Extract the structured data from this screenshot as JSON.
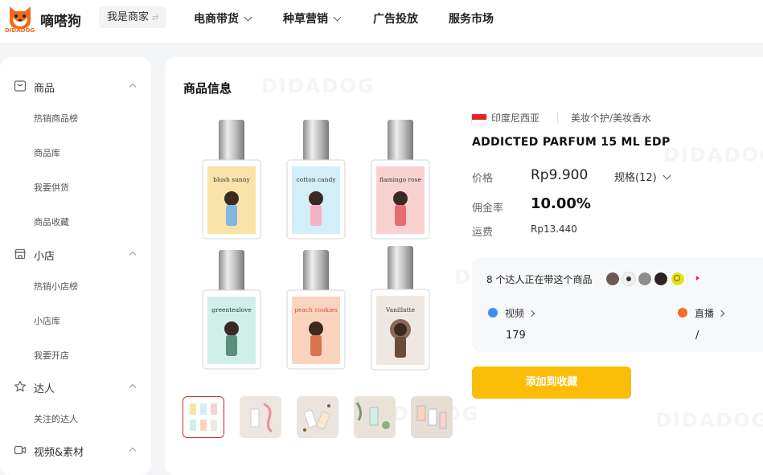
{
  "brand": {
    "name": "嘀嗒狗",
    "logo_text": "DIDADOG"
  },
  "header": {
    "merchant_label": "我是商家",
    "merchant_switch_glyph": "⇄",
    "nav": [
      {
        "label": "电商带货",
        "has_dropdown": true
      },
      {
        "label": "种草营销",
        "has_dropdown": true
      },
      {
        "label": "广告投放",
        "has_dropdown": false
      },
      {
        "label": "服务市场",
        "has_dropdown": false
      }
    ]
  },
  "sidebar": {
    "sections": [
      {
        "label": "商品",
        "icon": "product-box-icon",
        "items": [
          "热销商品榜",
          "商品库",
          "我要供货",
          "商品收藏"
        ]
      },
      {
        "label": "小店",
        "icon": "shop-icon",
        "items": [
          "热销小店榜",
          "小店库",
          "我要开店"
        ]
      },
      {
        "label": "达人",
        "icon": "star-icon",
        "items": [
          "关注的达人"
        ]
      },
      {
        "label": "视频&素材",
        "icon": "video-icon",
        "items": []
      }
    ]
  },
  "main": {
    "section_title": "商品信息",
    "watermark": "DIDADOG",
    "product": {
      "country": "印度尼西亚",
      "category": "美妆个护/美妆香水",
      "title": "ADDICTED PARFUM 15 ML EDP",
      "price_label": "价格",
      "price": "Rp9.900",
      "spec_label": "规格(12)",
      "commission_label": "佣金率",
      "commission": "10.00%",
      "shipping_label": "运费",
      "shipping": "Rp13.440",
      "bottle_labels": [
        "blush sunny",
        "cotton candy",
        "flamingo rose",
        "greentealove",
        "peach cookies",
        "Vanillatte"
      ]
    },
    "creators": {
      "count_text": "8 个达人正在带这个商品",
      "video_label": "视频",
      "video_count": "179",
      "live_label": "直播",
      "live_count": "/"
    },
    "favorite_button": "添加到收藏"
  },
  "colors": {
    "accent": "#fbbd08",
    "brand_orange": "#f26b1d",
    "selected_thumb": "#c8272c",
    "video_dot": "#3a8ef6",
    "live_dot": "#f56a2b"
  }
}
